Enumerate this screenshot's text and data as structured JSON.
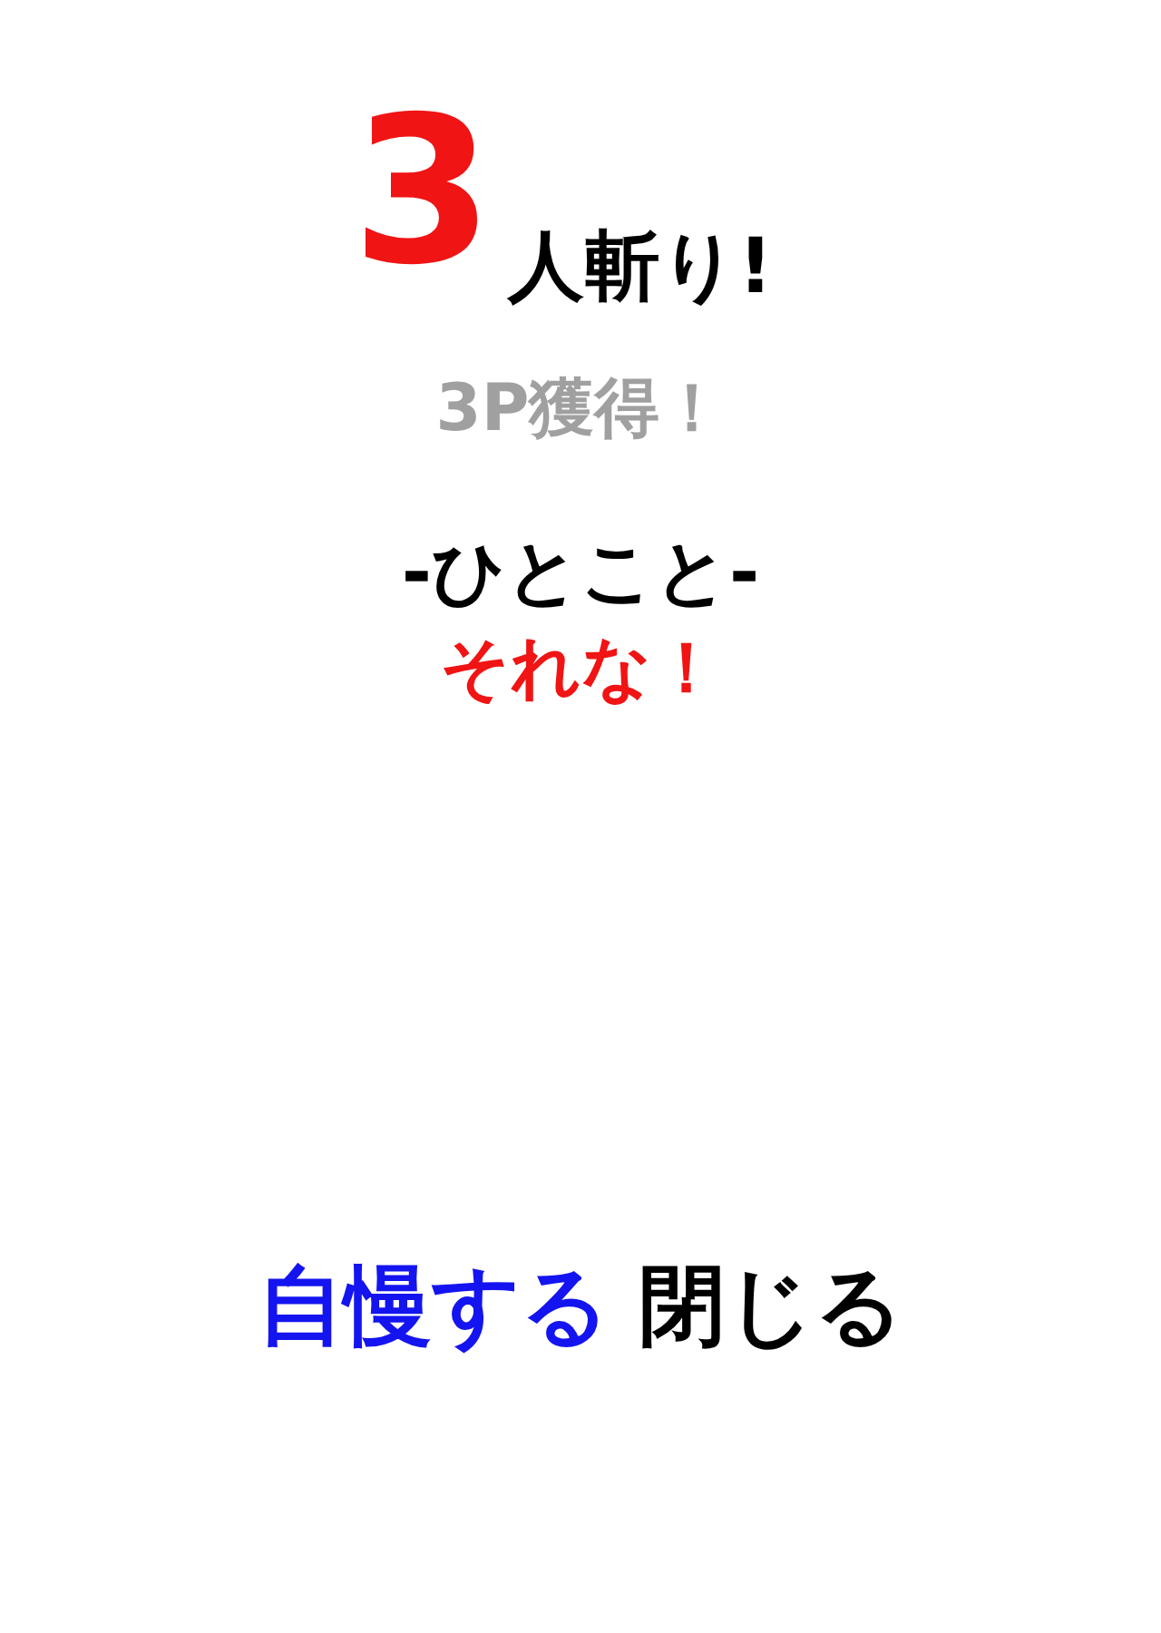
{
  "kill_count": "3",
  "kill_label": "人斬り!",
  "points": "3P獲得！",
  "comment_heading": "-ひとこと-",
  "comment": "それな！",
  "buttons": [
    {
      "label": "自慢する",
      "kind": "share"
    },
    {
      "label": "閉じる",
      "kind": "close"
    }
  ]
}
